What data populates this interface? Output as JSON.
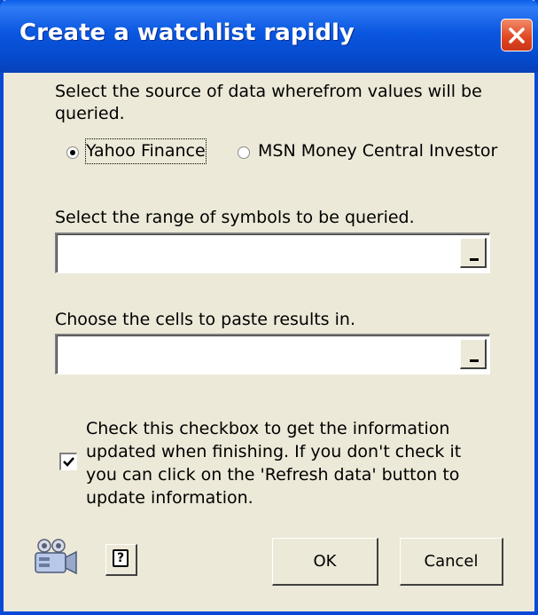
{
  "window": {
    "title": "Create a watchlist rapidly"
  },
  "source": {
    "prompt_line1": "Select the source of data wherefrom values will be",
    "prompt_line2": "queried.",
    "options": [
      {
        "label": "Yahoo Finance",
        "selected": true
      },
      {
        "label": "MSN Money Central Investor",
        "selected": false
      }
    ]
  },
  "symbols": {
    "label": "Select the range of symbols to be queried.",
    "value": ""
  },
  "results": {
    "label": "Choose the cells to paste results in.",
    "value": ""
  },
  "update": {
    "checked": true,
    "lines": [
      "Check this checkbox to get the information",
      "updated when finishing. If you don't check it",
      "you can click on the 'Refresh data' button to",
      "update information."
    ]
  },
  "buttons": {
    "ok": "OK",
    "cancel": "Cancel",
    "help": "?"
  },
  "colors": {
    "title_bar": "#0a57e0",
    "dialog_bg": "#ece9d8",
    "close_button": "#e0461f"
  },
  "icons": {
    "close": "close-icon",
    "help": "help-icon",
    "camera": "video-camera-icon",
    "checkmark": "checkmark-icon"
  }
}
